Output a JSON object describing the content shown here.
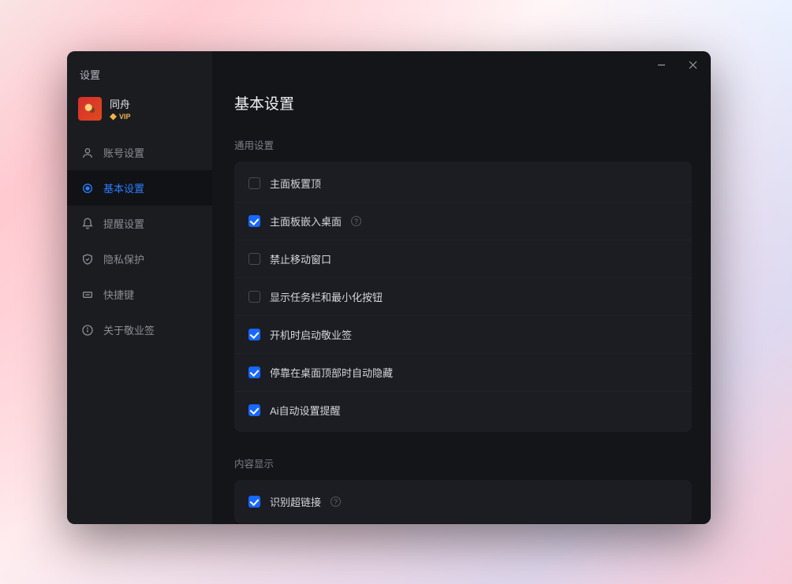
{
  "window_title": "设置",
  "profile": {
    "username": "同舟",
    "vip": "VIP"
  },
  "sidebar": {
    "items": [
      {
        "id": "account",
        "label": "账号设置"
      },
      {
        "id": "basic",
        "label": "基本设置"
      },
      {
        "id": "reminder",
        "label": "提醒设置"
      },
      {
        "id": "privacy",
        "label": "隐私保护"
      },
      {
        "id": "hotkey",
        "label": "快捷键"
      },
      {
        "id": "about",
        "label": "关于敬业签"
      }
    ],
    "active": "basic"
  },
  "page": {
    "title": "基本设置"
  },
  "sections": {
    "general": {
      "label": "通用设置",
      "items": [
        {
          "label": "主面板置顶",
          "checked": false,
          "help": false
        },
        {
          "label": "主面板嵌入桌面",
          "checked": true,
          "help": true
        },
        {
          "label": "禁止移动窗口",
          "checked": false,
          "help": false
        },
        {
          "label": "显示任务栏和最小化按钮",
          "checked": false,
          "help": false
        },
        {
          "label": "开机时启动敬业签",
          "checked": true,
          "help": false
        },
        {
          "label": "停靠在桌面顶部时自动隐藏",
          "checked": true,
          "help": false
        },
        {
          "label": "Ai自动设置提醒",
          "checked": true,
          "help": false
        }
      ]
    },
    "content_display": {
      "label": "内容显示",
      "items": [
        {
          "label": "识别超链接",
          "checked": true,
          "help": true
        }
      ]
    }
  },
  "help_glyph": "?"
}
